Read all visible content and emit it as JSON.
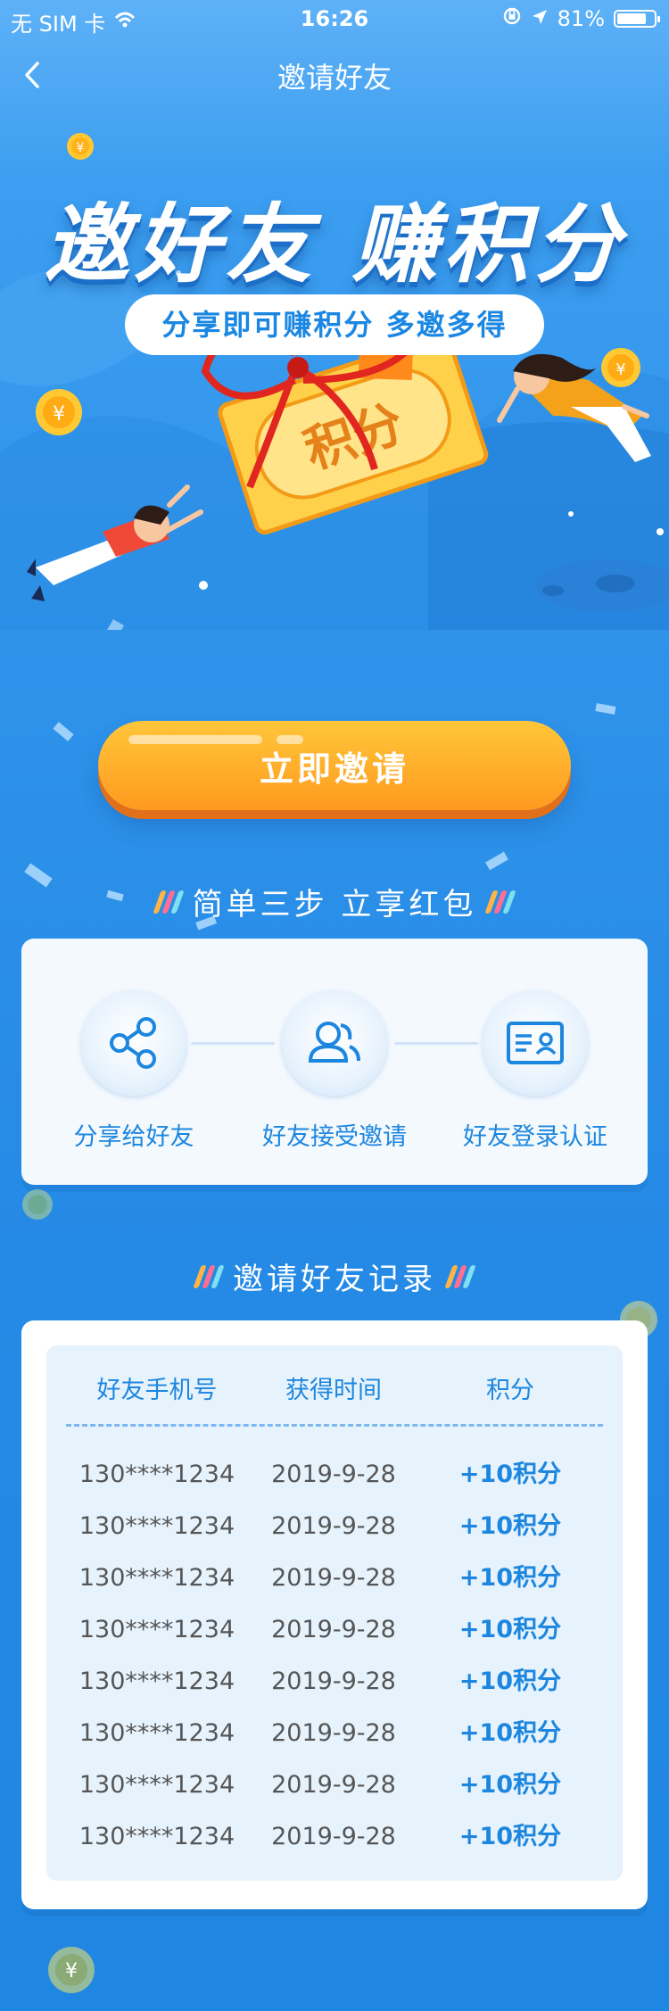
{
  "status_bar": {
    "carrier": "无 SIM 卡",
    "time": "16:26",
    "battery_percent": "81%",
    "battery_level": 0.81,
    "icons": [
      "wifi-icon",
      "rotation-lock-icon",
      "location-arrow-icon",
      "battery-icon"
    ]
  },
  "nav": {
    "title": "邀请好友",
    "back_icon": "chevron-left-icon"
  },
  "hero": {
    "title": "邀好友 赚积分",
    "subtitle": "分享即可赚积分 多邀多得",
    "ticket_text": "积分"
  },
  "cta": {
    "label": "立即邀请"
  },
  "steps_section": {
    "title": "简单三步 立享红包",
    "steps": [
      {
        "label": "分享给好友",
        "icon": "share-icon"
      },
      {
        "label": "好友接受邀请",
        "icon": "users-icon"
      },
      {
        "label": "好友登录认证",
        "icon": "id-card-icon"
      }
    ]
  },
  "records_section": {
    "title": "邀请好友记录",
    "headers": [
      "好友手机号",
      "获得时间",
      "积分"
    ],
    "rows": [
      [
        "130****1234",
        "2019-9-28",
        "+10积分"
      ],
      [
        "130****1234",
        "2019-9-28",
        "+10积分"
      ],
      [
        "130****1234",
        "2019-9-28",
        "+10积分"
      ],
      [
        "130****1234",
        "2019-9-28",
        "+10积分"
      ],
      [
        "130****1234",
        "2019-9-28",
        "+10积分"
      ],
      [
        "130****1234",
        "2019-9-28",
        "+10积分"
      ],
      [
        "130****1234",
        "2019-9-28",
        "+10积分"
      ],
      [
        "130****1234",
        "2019-9-28",
        "+10积分"
      ]
    ]
  },
  "colors": {
    "primary_blue": "#1d86de",
    "cta_orange": "#ff9a1f",
    "background_blue": "#2b8fe6"
  }
}
